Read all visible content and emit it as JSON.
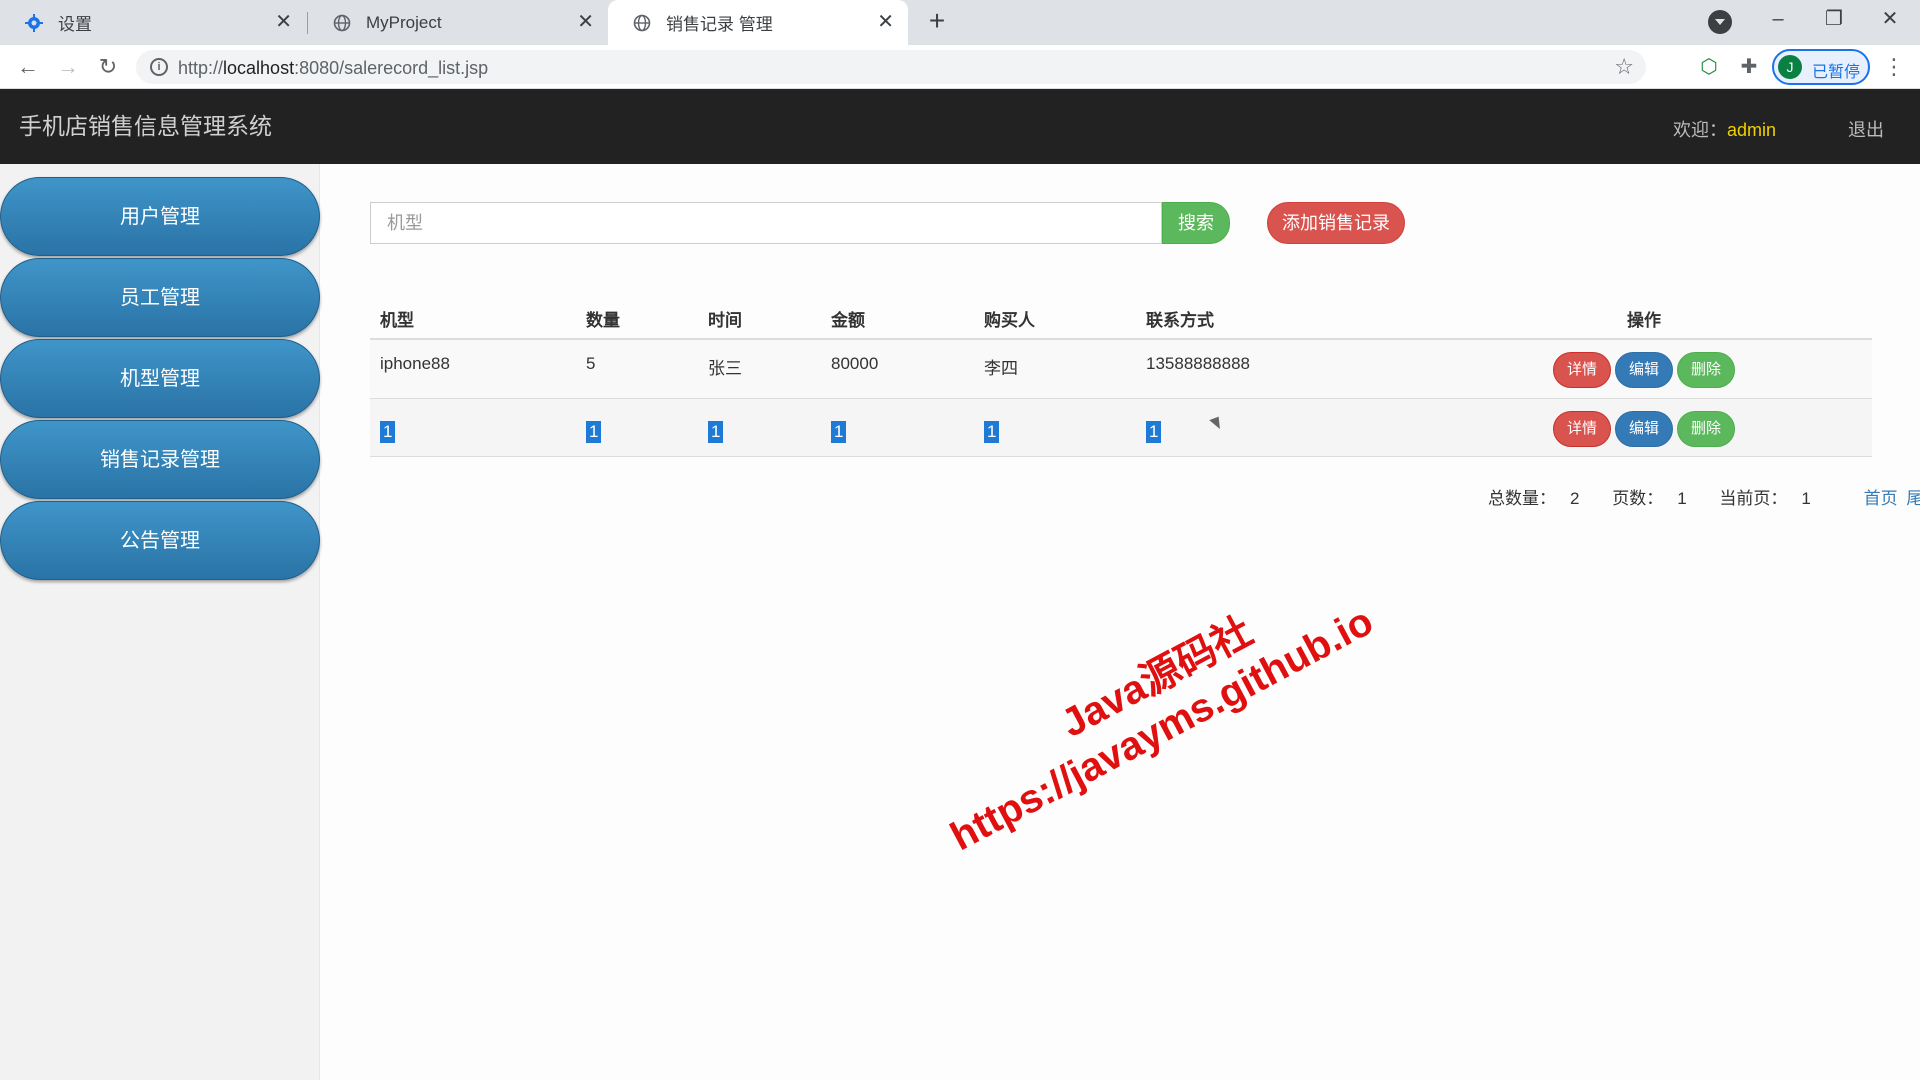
{
  "browser": {
    "tabs": [
      {
        "title": "设置"
      },
      {
        "title": "MyProject"
      },
      {
        "title": "销售记录 管理"
      }
    ],
    "url_prefix": "http://",
    "url_host": "localhost",
    "url_rest": ":8080/salerecord_list.jsp",
    "profile_initial": "J",
    "profile_status": "已暂停"
  },
  "header": {
    "title": "手机店销售信息管理系统",
    "welcome_label": "欢迎：",
    "username": "admin",
    "logout": "退出"
  },
  "sidebar": {
    "items": [
      {
        "label": "用户管理"
      },
      {
        "label": "员工管理"
      },
      {
        "label": "机型管理"
      },
      {
        "label": "销售记录管理"
      },
      {
        "label": "公告管理"
      }
    ]
  },
  "search": {
    "placeholder": "机型",
    "button": "搜索",
    "add_button": "添加销售记录"
  },
  "table": {
    "columns": [
      "机型",
      "数量",
      "时间",
      "金额",
      "购买人",
      "联系方式",
      "操作"
    ],
    "rows": [
      [
        "iphone88",
        "5",
        "张三",
        "80000",
        "李四",
        "13588888888"
      ],
      [
        "1",
        "1",
        "1",
        "1",
        "1",
        "1"
      ]
    ],
    "actions": {
      "detail": "详情",
      "edit": "编辑",
      "delete": "删除"
    }
  },
  "pager": {
    "total_label": "总数量：",
    "total": "2",
    "pages_label": "页数：",
    "pages": "1",
    "current_label": "当前页：",
    "current": "1",
    "first": "首页",
    "last": "尾页"
  },
  "watermark": {
    "line1": "Java源码社",
    "line2": "https://javayms.github.io"
  },
  "colors": {
    "header_bg": "#222222",
    "sidebar_item": "#2e7db3",
    "search_green": "#5cb85c",
    "add_red": "#d9534f",
    "edit_blue": "#337ab7",
    "username_yellow": "#f0d000"
  }
}
